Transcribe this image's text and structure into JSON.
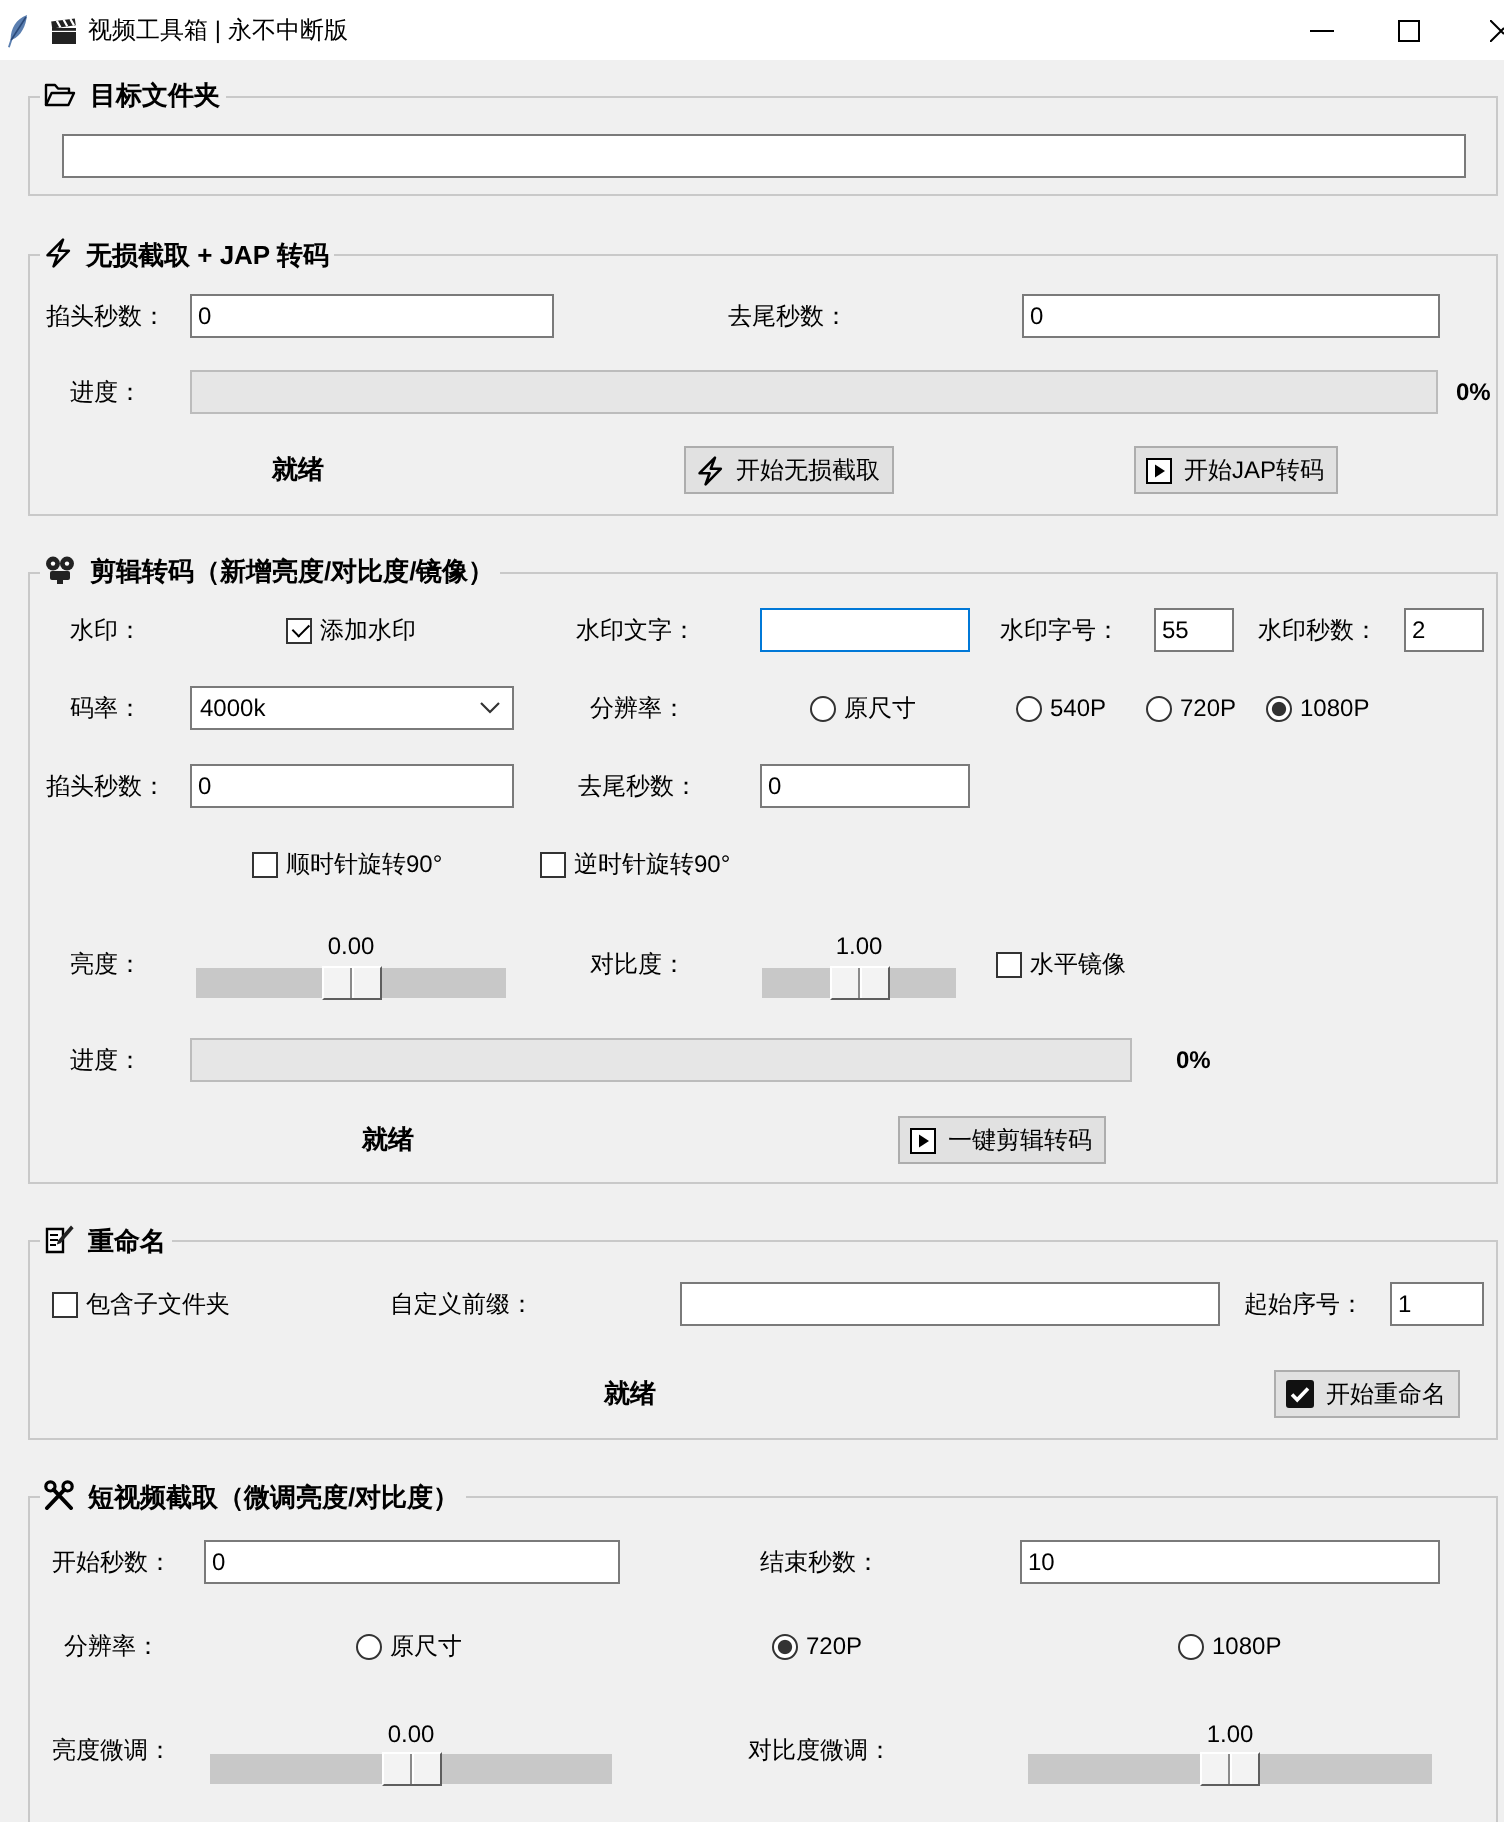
{
  "window": {
    "title": "视频工具箱 | 永不中断版"
  },
  "target_folder": {
    "title": "目标文件夹"
  },
  "lossless": {
    "title": "无损截取 + JAP 转码",
    "head_trim": {
      "label": "掐头秒数：",
      "value": "0"
    },
    "tail_trim": {
      "label": "去尾秒数：",
      "value": "0"
    },
    "progress": {
      "label": "进度：",
      "level": 0,
      "reading": "0%"
    },
    "status": "就绪",
    "buttons": [
      {
        "label": "开始无损截取"
      },
      {
        "label": "开始JAP转码"
      }
    ]
  },
  "edit": {
    "title": "剪辑转码（新增亮度/对比度/镜像）",
    "watermark": {
      "label": "水印：",
      "checkbox": {
        "label": "添加水印",
        "checked": true
      }
    },
    "watermark_text": {
      "label": "水印文字：",
      "focused": true
    },
    "watermark_size": {
      "label": "水印字号：",
      "value": "55"
    },
    "watermark_seconds": {
      "label": "水印秒数：",
      "value": "2"
    },
    "bitrate": {
      "label": "码率：",
      "value": "4000k"
    },
    "resolution": {
      "label": "分辨率：",
      "options": [
        {
          "label": "原尺寸",
          "selected": false
        },
        {
          "label": "540P",
          "selected": false
        },
        {
          "label": "720P",
          "selected": false
        },
        {
          "label": "1080P",
          "selected": true
        }
      ]
    },
    "head_trim": {
      "label": "掐头秒数：",
      "value": "0"
    },
    "tail_trim": {
      "label": "去尾秒数：",
      "value": "0"
    },
    "rotations": [
      {
        "label": "顺时针旋转90°",
        "checked": false
      },
      {
        "label": "逆时针旋转90°",
        "checked": false
      }
    ],
    "brightness": {
      "label": "亮度：",
      "reading": "0.00",
      "level": 0.5
    },
    "contrast": {
      "label": "对比度：",
      "reading": "1.00",
      "level": 0.5
    },
    "mirror": {
      "label": "水平镜像",
      "checked": false
    },
    "progress": {
      "label": "进度：",
      "level": 0,
      "reading": "0%"
    },
    "status": "就绪",
    "button": {
      "label": "一键剪辑转码"
    }
  },
  "rename": {
    "title": "重命名",
    "include_subfolders": {
      "label": "包含子文件夹",
      "checked": false
    },
    "prefix": {
      "label": "自定义前缀："
    },
    "start_number": {
      "label": "起始序号：",
      "value": "1"
    },
    "status": "就绪",
    "button": {
      "label": "开始重命名"
    }
  },
  "short_clip": {
    "title": "短视频截取（微调亮度/对比度）",
    "start": {
      "label": "开始秒数：",
      "value": "0"
    },
    "end": {
      "label": "结束秒数：",
      "value": "10"
    },
    "resolution": {
      "label": "分辨率：",
      "options": [
        {
          "label": "原尺寸",
          "selected": false
        },
        {
          "label": "720P",
          "selected": true
        },
        {
          "label": "1080P",
          "selected": false
        }
      ]
    },
    "brightness": {
      "label": "亮度微调：",
      "reading": "0.00",
      "level": 0.5
    },
    "contrast": {
      "label": "对比度微调：",
      "reading": "1.00",
      "level": 0.5
    }
  }
}
